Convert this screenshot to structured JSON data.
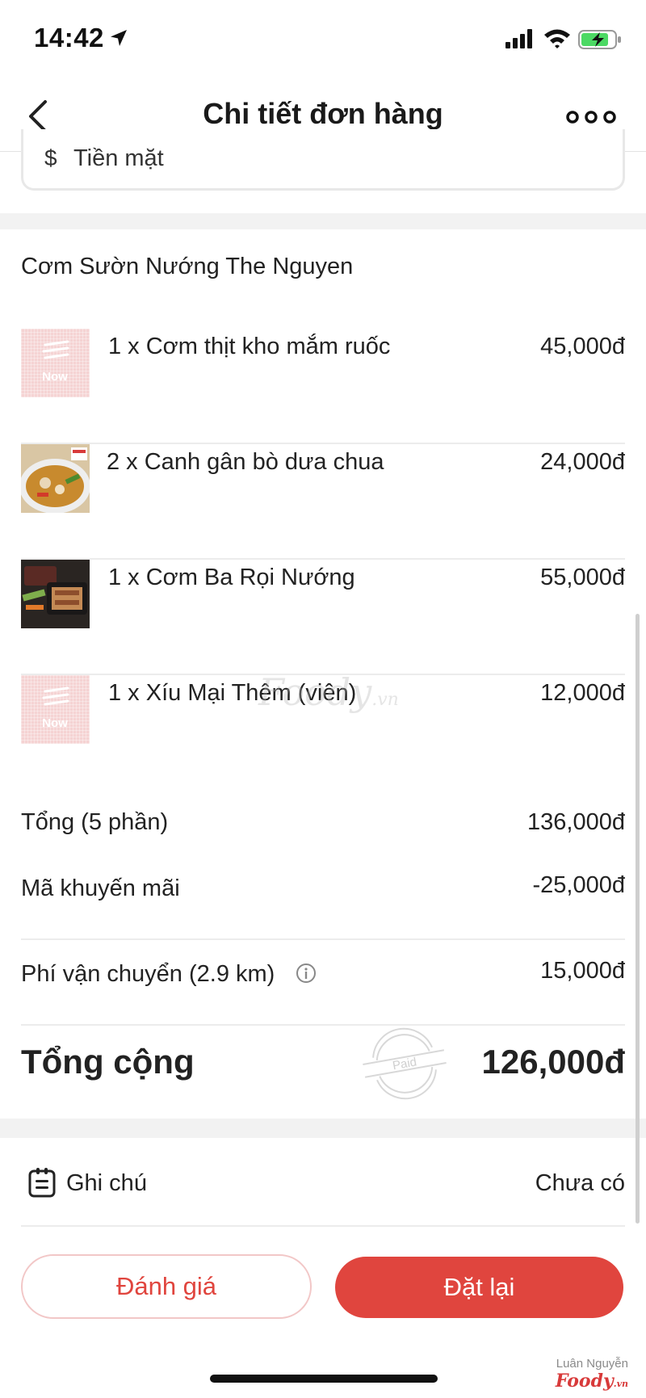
{
  "status_bar": {
    "time": "14:42"
  },
  "header": {
    "title": "Chi tiết đơn hàng"
  },
  "payment": {
    "icon": "$",
    "method": "Tiền mặt"
  },
  "restaurant": {
    "name": "Cơm Sườn Nướng The Nguyen"
  },
  "items": [
    {
      "name": "1 x Cơm thịt kho mắm ruốc",
      "price": "45,000đ",
      "image": "Now"
    },
    {
      "name": "2 x Canh gân bò dưa chua",
      "price": "24,000đ"
    },
    {
      "name": "1 x Cơm Ba Rọi Nướng",
      "price": "55,000đ"
    },
    {
      "name": "1 x Xíu Mại Thêm (viên)",
      "price": "12,000đ",
      "image": "Now"
    }
  ],
  "watermark": {
    "brand": "Foody",
    "suffix": ".vn"
  },
  "summary": {
    "subtotal_label": "Tổng (5 phần)",
    "subtotal_value": "136,000đ",
    "promo_label": "Mã khuyến mãi",
    "promo_value": "-25,000đ",
    "shipping_label": "Phí vận chuyển (2.9 km)",
    "shipping_value": "15,000đ"
  },
  "total": {
    "label": "Tổng cộng",
    "value": "126,000đ",
    "stamp": "Paid"
  },
  "note": {
    "label": "Ghi chú",
    "value": "Chưa có"
  },
  "buttons": {
    "rate": "Đánh giá",
    "reorder": "Đặt lại"
  },
  "credit": {
    "name": "Luân Nguyễn",
    "logo": "Foody",
    "logo_suffix": ".vn"
  },
  "colors": {
    "accent": "#e0453e",
    "divider": "#ececec",
    "placeholder": "#f5d3d3"
  }
}
